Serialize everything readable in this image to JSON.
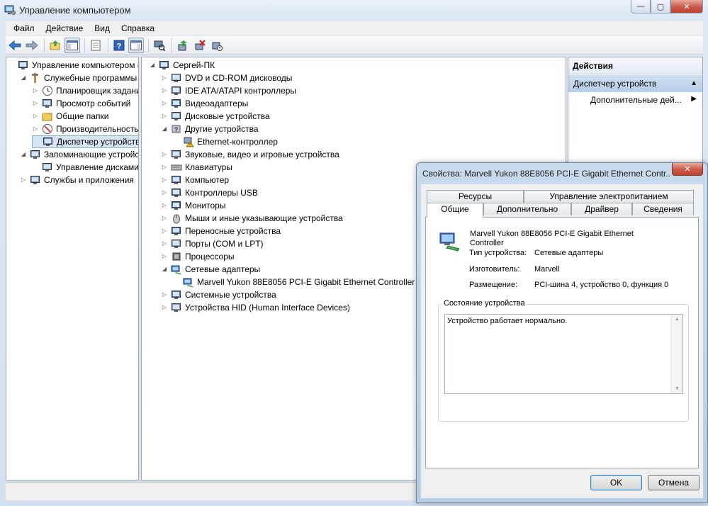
{
  "window": {
    "title": "Управление компьютером",
    "controls": {
      "minimize": "—",
      "maximize": "▢",
      "close": "✕"
    }
  },
  "menu": [
    "Файл",
    "Действие",
    "Вид",
    "Справка"
  ],
  "left_tree": [
    {
      "label": "Управление компьютером (л",
      "expander": "",
      "icon": "computer-management-icon",
      "indent": 0
    },
    {
      "label": "Служебные программы",
      "expander": "◢",
      "icon": "tools-icon",
      "indent": 1
    },
    {
      "label": "Планировщик заданий",
      "expander": "▷",
      "icon": "clock-icon",
      "indent": 2
    },
    {
      "label": "Просмотр событий",
      "expander": "▷",
      "icon": "event-viewer-icon",
      "indent": 2
    },
    {
      "label": "Общие папки",
      "expander": "▷",
      "icon": "shared-folder-icon",
      "indent": 2
    },
    {
      "label": "Производительность",
      "expander": "▷",
      "icon": "performance-icon",
      "indent": 2
    },
    {
      "label": "Диспетчер устройств",
      "expander": "",
      "icon": "device-manager-icon",
      "indent": 2,
      "selected": true
    },
    {
      "label": "Запоминающие устройст",
      "expander": "◢",
      "icon": "storage-icon",
      "indent": 1
    },
    {
      "label": "Управление дисками",
      "expander": "",
      "icon": "disk-management-icon",
      "indent": 2
    },
    {
      "label": "Службы и приложения",
      "expander": "▷",
      "icon": "services-icon",
      "indent": 1
    }
  ],
  "device_tree": [
    {
      "label": "Сергей-ПК",
      "expander": "◢",
      "icon": "computer-icon",
      "indent": 0
    },
    {
      "label": "DVD и CD-ROM дисководы",
      "expander": "▷",
      "icon": "dvd-drive-icon",
      "indent": 1
    },
    {
      "label": "IDE ATA/ATAPI контроллеры",
      "expander": "▷",
      "icon": "ide-controller-icon",
      "indent": 1
    },
    {
      "label": "Видеоадаптеры",
      "expander": "▷",
      "icon": "display-adapter-icon",
      "indent": 1
    },
    {
      "label": "Дисковые устройства",
      "expander": "▷",
      "icon": "disk-drive-icon",
      "indent": 1
    },
    {
      "label": "Другие устройства",
      "expander": "◢",
      "icon": "unknown-device-icon",
      "indent": 1
    },
    {
      "label": "Ethernet-контроллер",
      "expander": "",
      "icon": "warning-device-icon",
      "indent": 2
    },
    {
      "label": "Звуковые, видео и игровые устройства",
      "expander": "▷",
      "icon": "sound-icon",
      "indent": 1
    },
    {
      "label": "Клавиатуры",
      "expander": "▷",
      "icon": "keyboard-icon",
      "indent": 1
    },
    {
      "label": "Компьютер",
      "expander": "▷",
      "icon": "computer-small-icon",
      "indent": 1
    },
    {
      "label": "Контроллеры USB",
      "expander": "▷",
      "icon": "usb-icon",
      "indent": 1
    },
    {
      "label": "Мониторы",
      "expander": "▷",
      "icon": "monitor-icon",
      "indent": 1
    },
    {
      "label": "Мыши и иные указывающие устройства",
      "expander": "▷",
      "icon": "mouse-icon",
      "indent": 1
    },
    {
      "label": "Переносные устройства",
      "expander": "▷",
      "icon": "portable-device-icon",
      "indent": 1
    },
    {
      "label": "Порты (COM и LPT)",
      "expander": "▷",
      "icon": "port-icon",
      "indent": 1
    },
    {
      "label": "Процессоры",
      "expander": "▷",
      "icon": "processor-icon",
      "indent": 1
    },
    {
      "label": "Сетевые адаптеры",
      "expander": "◢",
      "icon": "network-adapter-icon",
      "indent": 1
    },
    {
      "label": "Marvell Yukon 88E8056 PCI-E Gigabit Ethernet Controller",
      "expander": "",
      "icon": "network-card-icon",
      "indent": 2
    },
    {
      "label": "Системные устройства",
      "expander": "▷",
      "icon": "system-device-icon",
      "indent": 1
    },
    {
      "label": "Устройства HID (Human Interface Devices)",
      "expander": "▷",
      "icon": "hid-icon",
      "indent": 1
    }
  ],
  "actions": {
    "header": "Действия",
    "section": "Диспетчер устройств",
    "item": "Дополнительные дей..."
  },
  "dialog": {
    "title": "Свойства: Marvell Yukon 88E8056 PCI-E Gigabit Ethernet Contr...",
    "close": "✕",
    "tabs_top": [
      "Ресурсы",
      "Управление электропитанием"
    ],
    "tabs_bottom": [
      "Общие",
      "Дополнительно",
      "Драйвер",
      "Сведения"
    ],
    "device_name": "Marvell Yukon 88E8056 PCI-E Gigabit Ethernet Controller",
    "props": [
      {
        "label": "Тип устройства:",
        "value": "Сетевые адаптеры"
      },
      {
        "label": "Изготовитель:",
        "value": "Marvell"
      },
      {
        "label": "Размещение:",
        "value": "PCI-шина 4, устройство 0, функция 0"
      }
    ],
    "status_group_title": "Состояние устройства",
    "status_text": "Устройство работает нормально.",
    "ok": "OK",
    "cancel": "Отмена"
  },
  "colors": {
    "selection": "#d6e4f5",
    "actions_section": "#b8cfe9",
    "close_button": "#c9584a"
  }
}
